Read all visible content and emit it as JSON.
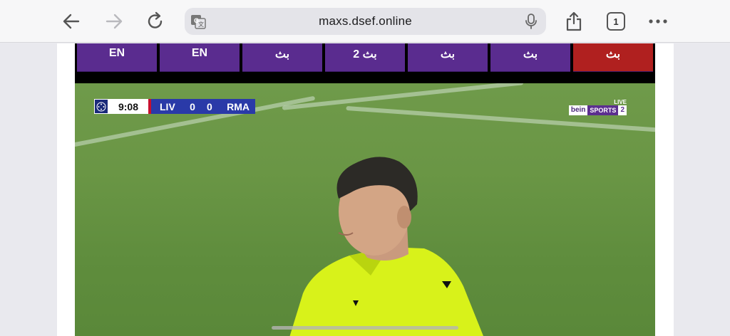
{
  "browser": {
    "url": "maxs.dsef.online",
    "tab_count": "1"
  },
  "channels": [
    {
      "label": "EN",
      "active": false
    },
    {
      "label": "EN",
      "active": false
    },
    {
      "label": "بث",
      "active": false
    },
    {
      "label": "بث 2",
      "active": false
    },
    {
      "label": "بث",
      "active": false
    },
    {
      "label": "بث",
      "active": false
    },
    {
      "label": "بث",
      "active": true
    }
  ],
  "scoreboard": {
    "clock": "9:08",
    "home_team": "LIV",
    "home_score": "0",
    "away_score": "0",
    "away_team": "RMA"
  },
  "broadcaster": {
    "live": "LIVE",
    "brand": "bein",
    "sports": "SPORTS",
    "channel_number": "2"
  },
  "colors": {
    "channel_button": "#5a2c8f",
    "channel_button_active": "#b0201f",
    "referee_shirt": "#d8f21a"
  }
}
